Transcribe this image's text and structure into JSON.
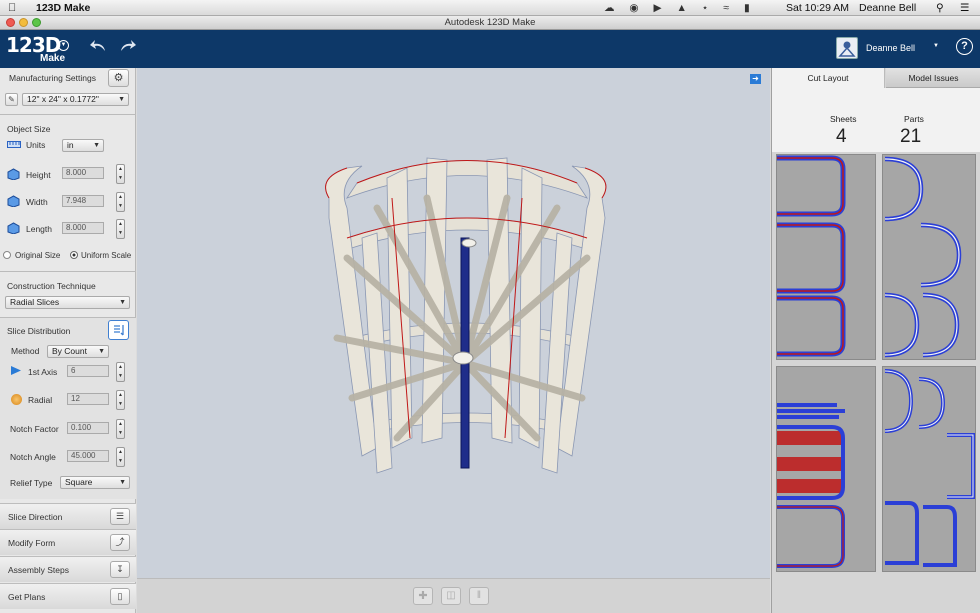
{
  "menubar": {
    "app_name": "123D Make",
    "clock": "Sat 10:29 AM",
    "user": "Deanne Bell"
  },
  "window": {
    "title": "Autodesk 123D Make"
  },
  "appbar": {
    "logo_main": "123D",
    "logo_sub": "Make",
    "user_name": "Deanne Bell",
    "help_label": "?"
  },
  "left": {
    "manufacturing_settings": "Manufacturing Settings",
    "material": "12\" x 24\" x 0.1772\"",
    "object_size": "Object Size",
    "units_label": "Units",
    "units_value": "in",
    "height_label": "Height",
    "height_value": "8.000",
    "width_label": "Width",
    "width_value": "7.948",
    "length_label": "Length",
    "length_value": "8.000",
    "original_size": "Original Size",
    "uniform_scale": "Uniform Scale",
    "construction_technique": "Construction Technique",
    "technique_value": "Radial Slices",
    "slice_distribution": "Slice Distribution",
    "method_label": "Method",
    "method_value": "By Count",
    "axis1_label": "1st Axis",
    "axis1_value": "6",
    "radial_label": "Radial",
    "radial_value": "12",
    "notch_factor_label": "Notch Factor",
    "notch_factor_value": "0.100",
    "notch_angle_label": "Notch Angle",
    "notch_angle_value": "45.000",
    "relief_type_label": "Relief Type",
    "relief_type_value": "Square",
    "nav": [
      {
        "label": "Slice Direction"
      },
      {
        "label": "Modify Form"
      },
      {
        "label": "Assembly Steps"
      },
      {
        "label": "Get Plans"
      }
    ]
  },
  "right": {
    "tab_cut_layout": "Cut Layout",
    "tab_model_issues": "Model Issues",
    "sheets_label": "Sheets",
    "sheets_value": "4",
    "parts_label": "Parts",
    "parts_value": "21"
  },
  "colors": {
    "appbar": "#0d3868",
    "viewport": "#cbd1da",
    "part_outline": "#2b3fd6",
    "engrave": "#c01818",
    "slice_fill": "#e5e1d6"
  },
  "icons": [
    "apple-icon",
    "gear-icon",
    "pencil-icon",
    "undo-icon",
    "redo-icon",
    "help-icon",
    "add-icon",
    "trash-icon",
    "slice-icon"
  ]
}
